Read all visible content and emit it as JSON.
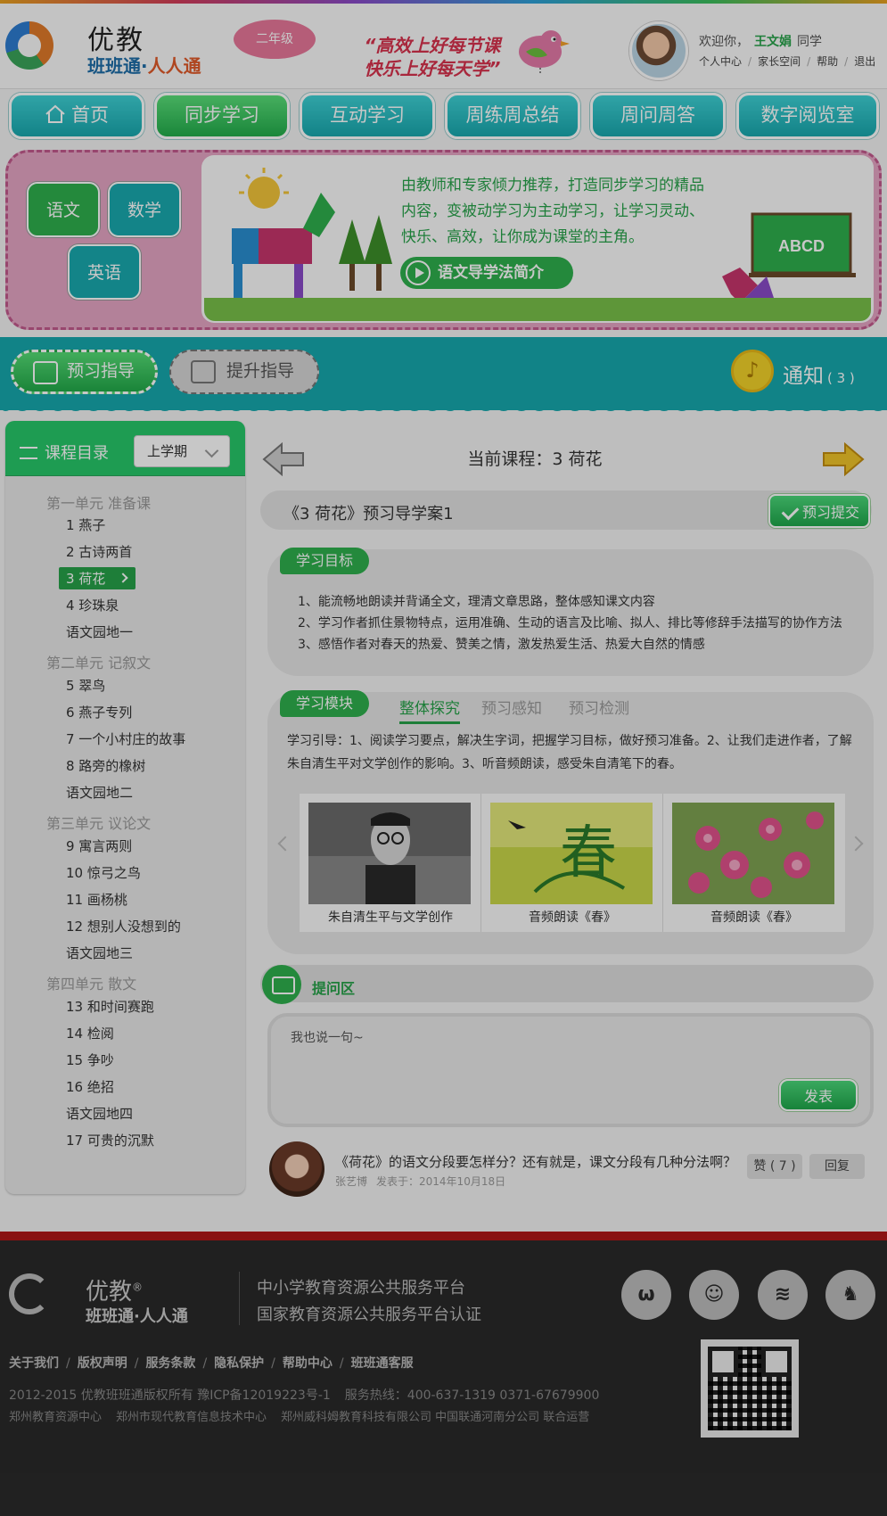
{
  "header": {
    "logo_line1": "优教",
    "logo_line2_a": "班班通·",
    "logo_line2_b": "人人通",
    "grade": "二年级",
    "slogan_1": "“高效上好每节课",
    "slogan_2": "快乐上好每天学”",
    "welcome_prefix": "欢迎你，",
    "user_name": "王文娟",
    "user_suffix": "同学",
    "links": [
      "个人中心",
      "家长空间",
      "帮助",
      "退出"
    ]
  },
  "nav": [
    "首页",
    "同步学习",
    "互动学习",
    "周练周总结",
    "周问周答",
    "数字阅览室"
  ],
  "banner": {
    "subjects": [
      "语文",
      "数学",
      "英语"
    ],
    "text": "由教师和专家倾力推荐，打造同步学习的精品内容，变被动学习为主动学习，让学习灵动、快乐、高效，让你成为课堂的主角。",
    "intro_button": "语文导学法简介",
    "board_text": "ABCD"
  },
  "guide_bar": {
    "preview": "预习指导",
    "improve": "提升指导",
    "notice": "通知",
    "notice_count": "( 3 )"
  },
  "sidebar": {
    "title": "课程目录",
    "semester": "上学期",
    "units": [
      {
        "name": "第一单元 准备课",
        "lessons": [
          "1 燕子",
          "2 古诗两首",
          "3 荷花",
          "4 珍珠泉",
          "语文园地一"
        ]
      },
      {
        "name": "第二单元 记叙文",
        "lessons": [
          "5 翠鸟",
          "6 燕子专列",
          "7 一个小村庄的故事",
          "8 路旁的橡树",
          "语文园地二"
        ]
      },
      {
        "name": "第三单元 议论文",
        "lessons": [
          "9 寓言两则",
          "10 惊弓之鸟",
          "11 画杨桃",
          "12 想别人没想到的",
          "语文园地三"
        ]
      },
      {
        "name": "第四单元 散文",
        "lessons": [
          "13 和时间赛跑",
          "14 检阅",
          "15 争吵",
          "16 绝招",
          "语文园地四",
          "17 可贵的沉默"
        ]
      }
    ]
  },
  "main": {
    "current_course": "当前课程：3 荷花",
    "lesson_title": "《3 荷花》预习导学案1",
    "submit": "预习提交",
    "goals_tag": "学习目标",
    "goals": [
      "1、能流畅地朗读并背诵全文，理清文章思路，整体感知课文内容",
      "2、学习作者抓住景物特点，运用准确、生动的语言及比喻、拟人、排比等修辞手法描写的协作方法",
      "3、感悟作者对春天的热爱、赞美之情，激发热爱生活、热爱大自然的情感"
    ],
    "module_tag": "学习模块",
    "tabs": [
      "整体探究",
      "预习感知",
      "预习检测"
    ],
    "guide": "学习引导：1、阅读学习要点，解决生字词，把握学习目标，做好预习准备。2、让我们走进作者，了解朱自清生平对文学创作的影响。3、听音频朗读，感受朱自清笔下的春。",
    "media": [
      {
        "caption": "朱自清生平与文学创作"
      },
      {
        "caption": "音频朗读《春》",
        "art_text": "春"
      },
      {
        "caption": "音频朗读《春》"
      }
    ],
    "qa_label": "提问区",
    "comment_placeholder": "我也说一句~",
    "post": "发表",
    "comment": {
      "text": "《荷花》的语文分段要怎样分？还有就是，课文分段有几种分法啊？",
      "author": "张艺博",
      "date": "发表于：2014年10月18日",
      "like": "赞 ( 7 )",
      "reply": "回复"
    }
  },
  "footer": {
    "logo1": "优教",
    "reg": "®",
    "logo2": "班班通·人人通",
    "platform1": "中小学教育资源公共服务平台",
    "platform2": "国家教育资源公共服务平台认证",
    "links": [
      "关于我们",
      "版权声明",
      "服务条款",
      "隐私保护",
      "帮助中心",
      "班班通客服"
    ],
    "copyright": "2012-2015 优教班班通版权所有  豫ICP备12019223号-1",
    "hotline": "服务热线：400-637-1319   0371-67679900",
    "corps": [
      "郑州教育资源中心",
      "郑州市现代教育信息技术中心",
      "郑州威科姆教育科技有限公司 中国联通河南分公司  联合运营"
    ]
  }
}
